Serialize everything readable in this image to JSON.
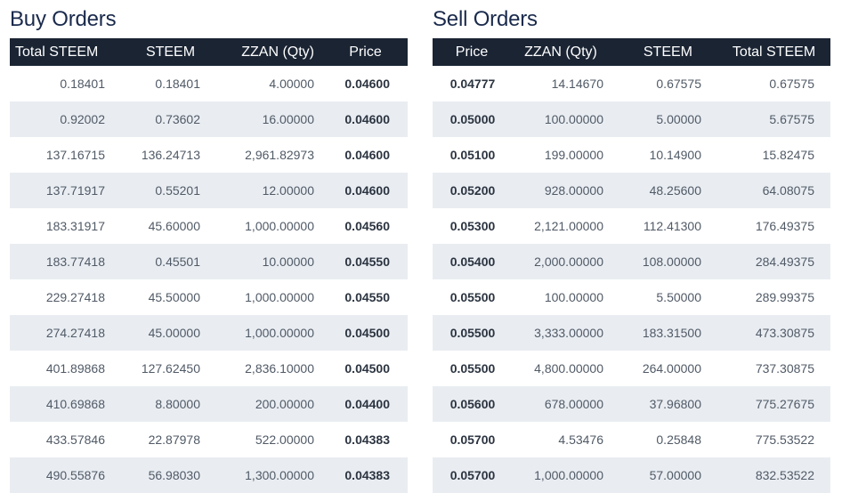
{
  "buy": {
    "title": "Buy Orders",
    "headers": [
      "Total STEEM",
      "STEEM",
      "ZZAN (Qty)",
      "Price"
    ],
    "rows": [
      [
        "0.18401",
        "0.18401",
        "4.00000",
        "0.04600"
      ],
      [
        "0.92002",
        "0.73602",
        "16.00000",
        "0.04600"
      ],
      [
        "137.16715",
        "136.24713",
        "2,961.82973",
        "0.04600"
      ],
      [
        "137.71917",
        "0.55201",
        "12.00000",
        "0.04600"
      ],
      [
        "183.31917",
        "45.60000",
        "1,000.00000",
        "0.04560"
      ],
      [
        "183.77418",
        "0.45501",
        "10.00000",
        "0.04550"
      ],
      [
        "229.27418",
        "45.50000",
        "1,000.00000",
        "0.04550"
      ],
      [
        "274.27418",
        "45.00000",
        "1,000.00000",
        "0.04500"
      ],
      [
        "401.89868",
        "127.62450",
        "2,836.10000",
        "0.04500"
      ],
      [
        "410.69868",
        "8.80000",
        "200.00000",
        "0.04400"
      ],
      [
        "433.57846",
        "22.87978",
        "522.00000",
        "0.04383"
      ],
      [
        "490.55876",
        "56.98030",
        "1,300.00000",
        "0.04383"
      ]
    ]
  },
  "sell": {
    "title": "Sell Orders",
    "headers": [
      "Price",
      "ZZAN (Qty)",
      "STEEM",
      "Total STEEM"
    ],
    "rows": [
      [
        "0.04777",
        "14.14670",
        "0.67575",
        "0.67575"
      ],
      [
        "0.05000",
        "100.00000",
        "5.00000",
        "5.67575"
      ],
      [
        "0.05100",
        "199.00000",
        "10.14900",
        "15.82475"
      ],
      [
        "0.05200",
        "928.00000",
        "48.25600",
        "64.08075"
      ],
      [
        "0.05300",
        "2,121.00000",
        "112.41300",
        "176.49375"
      ],
      [
        "0.05400",
        "2,000.00000",
        "108.00000",
        "284.49375"
      ],
      [
        "0.05500",
        "100.00000",
        "5.50000",
        "289.99375"
      ],
      [
        "0.05500",
        "3,333.00000",
        "183.31500",
        "473.30875"
      ],
      [
        "0.05500",
        "4,800.00000",
        "264.00000",
        "737.30875"
      ],
      [
        "0.05600",
        "678.00000",
        "37.96800",
        "775.27675"
      ],
      [
        "0.05700",
        "4.53476",
        "0.25848",
        "775.53522"
      ],
      [
        "0.05700",
        "1,000.00000",
        "57.00000",
        "832.53522"
      ]
    ]
  },
  "colors": {
    "header_bg": "#1a2433",
    "title": "#1a2a4c",
    "stripe": "#e9edf2"
  }
}
